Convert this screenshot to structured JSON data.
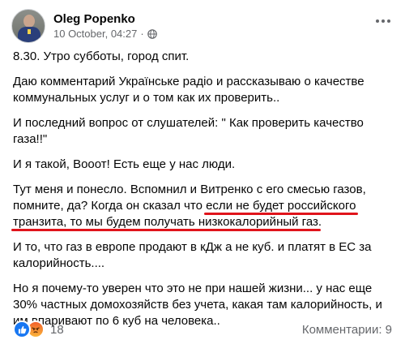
{
  "post": {
    "author": "Oleg Popenko",
    "date": "10 October, 04:27",
    "separator": "·",
    "paragraphs": {
      "p1": "8.30. Утро субботы, город спит.",
      "p2": "Даю комментарий Українське радіо  и рассказываю о качестве коммунальных услуг и о том как их проверить..",
      "p3": "И последний вопрос от слушателей: \" Как проверить качество газа!!\"",
      "p4": "И я такой, Вооот! Есть еще у нас люди.",
      "p5_plain": "Тут меня и понесло. Вспомнил и Витренко с его смесью газов, помните,  да? Когда он сказал что ",
      "p5_u1": "если не будет российского",
      "p5_u2": "транзита, то мы будем получать низкокалорийный газ",
      "p5_end": ".",
      "p6": "И то, что газ в европе продают в кДж а не куб. и платят в ЕС за калорийность....",
      "p7": "Но я почему-то уверен что это не при нашей жизни... у нас еще 30% частных домохозяйств без учета, какая там калорийность, и им впаривают по 6 куб на человека.."
    }
  },
  "footer": {
    "reaction_count": "18",
    "comments_label": "Комментарии: 9"
  },
  "colors": {
    "underline": "#e0141b",
    "like": "#1877f2",
    "meta": "#65676b"
  },
  "icons": {
    "privacy": "globe-icon",
    "menu": "more-options-icon",
    "reactions": [
      "like-icon",
      "angry-icon"
    ]
  }
}
